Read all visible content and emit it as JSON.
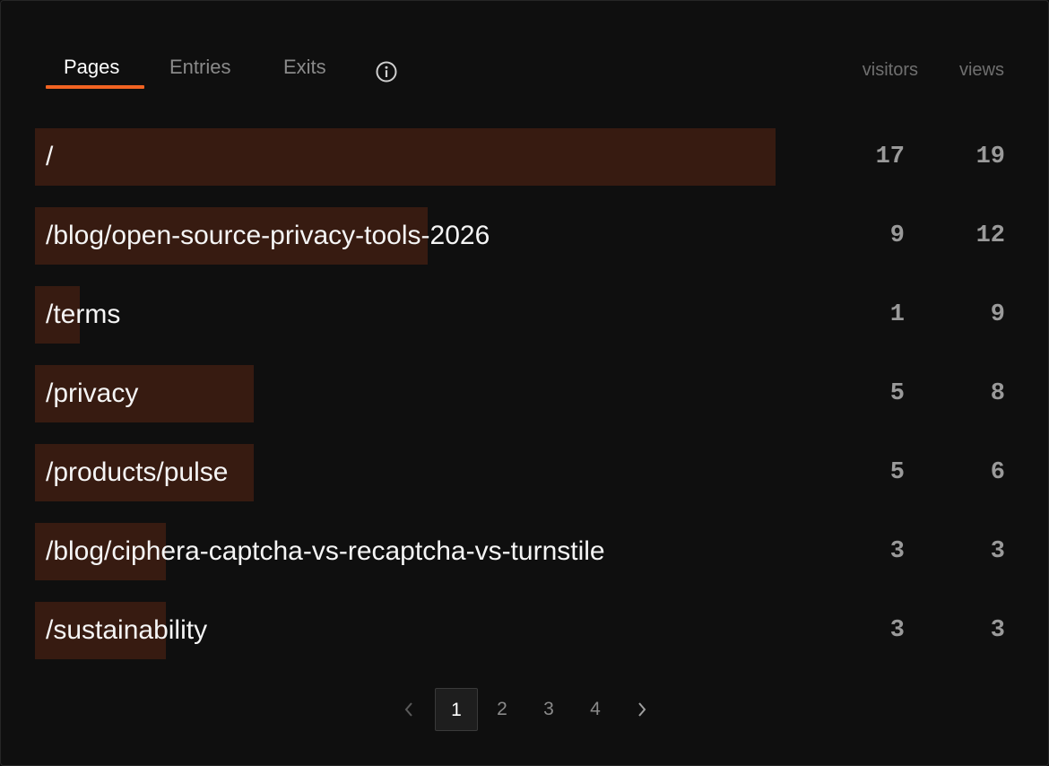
{
  "tabs": [
    {
      "label": "Pages"
    },
    {
      "label": "Entries"
    },
    {
      "label": "Exits"
    }
  ],
  "columns": {
    "visitors": "visitors",
    "views": "views"
  },
  "rows": [
    {
      "path": "/",
      "visitors": "17",
      "views": "19",
      "share": 1.0
    },
    {
      "path": "/blog/open-source-privacy-tools-2026",
      "visitors": "9",
      "views": "12",
      "share": 0.53
    },
    {
      "path": "/terms",
      "visitors": "1",
      "views": "9",
      "share": 0.06
    },
    {
      "path": "/privacy",
      "visitors": "5",
      "views": "8",
      "share": 0.295
    },
    {
      "path": "/products/pulse",
      "visitors": "5",
      "views": "6",
      "share": 0.295
    },
    {
      "path": "/blog/ciphera-captcha-vs-recaptcha-vs-turnstile",
      "visitors": "3",
      "views": "3",
      "share": 0.177
    },
    {
      "path": "/sustainability",
      "visitors": "3",
      "views": "3",
      "share": 0.177
    }
  ],
  "pagination": {
    "pages": [
      "1",
      "2",
      "3",
      "4"
    ],
    "current": "1"
  },
  "colors": {
    "accent": "#f26322",
    "bar": "#371b11"
  }
}
